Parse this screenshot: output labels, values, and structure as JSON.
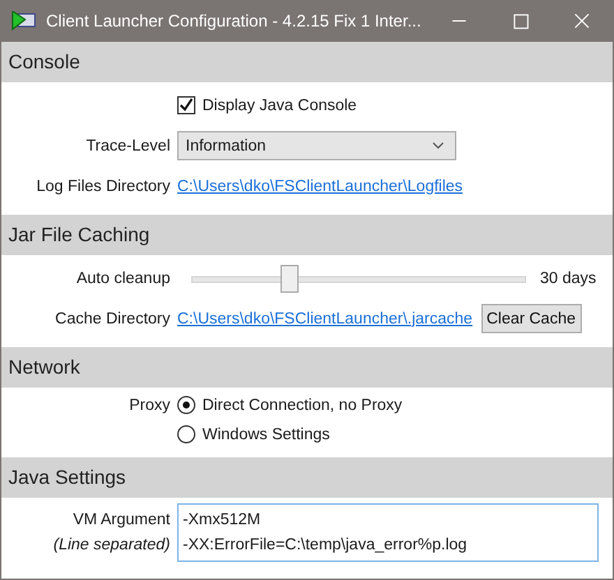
{
  "window": {
    "title": "Client Launcher Configuration - 4.2.15 Fix 1 Inter..."
  },
  "sections": [
    {
      "title": "Console",
      "rows": [
        {
          "kind": "checkbox",
          "text": "Display Java Console",
          "checked": true
        },
        {
          "kind": "select",
          "label": "Trace-Level",
          "value": "Information"
        },
        {
          "kind": "link",
          "label": "Log Files Directory",
          "value": "C:\\Users\\dko\\FSClientLauncher\\Logfiles"
        }
      ]
    },
    {
      "title": "Jar File Caching",
      "rows": [
        {
          "kind": "slider",
          "label": "Auto cleanup",
          "level": 0.29,
          "reading": "30 days"
        },
        {
          "kind": "link_button",
          "label": "Cache Directory",
          "value": "C:\\Users\\dko\\FSClientLauncher\\.jarcache",
          "button": "Clear Cache"
        }
      ]
    },
    {
      "title": "Network",
      "rows": [
        {
          "kind": "radio",
          "label": "Proxy",
          "options": [
            {
              "text": "Direct Connection, no Proxy",
              "selected": true
            },
            {
              "text": "Windows Settings",
              "selected": false
            }
          ]
        }
      ]
    },
    {
      "title": "Java Settings",
      "rows": [
        {
          "kind": "textarea",
          "label": "VM Argument",
          "sublabel": "(Line separated)",
          "lines": [
            "-Xmx512M",
            "-XX:ErrorFile=C:\\temp\\java_error%p.log"
          ]
        }
      ]
    }
  ]
}
